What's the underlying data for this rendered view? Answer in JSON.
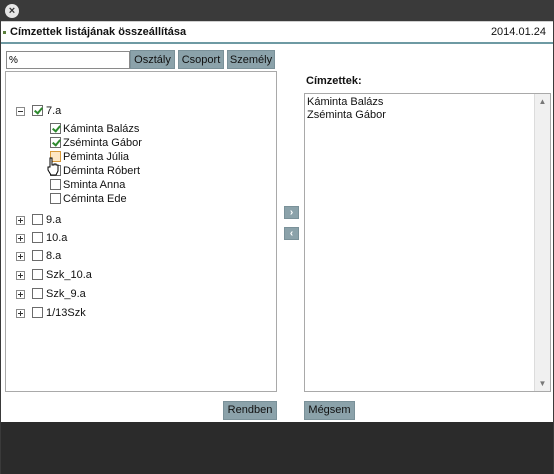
{
  "window": {
    "close_icon": "×"
  },
  "header": {
    "title": "Címzettek listájának összeállítása",
    "date": "2014.01.24"
  },
  "filter": {
    "search_value": "%",
    "buttons": {
      "osztaly": "Osztály",
      "csoport": "Csoport",
      "szemely": "Személy"
    }
  },
  "tree": {
    "groups": [
      {
        "label": "7.a",
        "expanded": true,
        "checked": true,
        "children": [
          {
            "label": "Káminta Balázs",
            "checked": true
          },
          {
            "label": "Zséminta Gábor",
            "checked": true
          },
          {
            "label": "Péminta Júlia",
            "checked": false,
            "hover": true
          },
          {
            "label": "Déminta Róbert",
            "checked": false
          },
          {
            "label": "Sminta Anna",
            "checked": false
          },
          {
            "label": "Céminta Ede",
            "checked": false
          }
        ]
      },
      {
        "label": "9.a",
        "expanded": false,
        "checked": false
      },
      {
        "label": "10.a",
        "expanded": false,
        "checked": false
      },
      {
        "label": "8.a",
        "expanded": false,
        "checked": false
      },
      {
        "label": "Szk_10.a",
        "expanded": false,
        "checked": false
      },
      {
        "label": "Szk_9.a",
        "expanded": false,
        "checked": false
      },
      {
        "label": "1/13Szk",
        "expanded": false,
        "checked": false
      }
    ]
  },
  "transfer": {
    "add_icon": "›",
    "remove_icon": "‹"
  },
  "recipients": {
    "label": "Címzettek:",
    "items": [
      "Káminta Balázs",
      "Zséminta Gábor"
    ],
    "scroll_up_icon": "▲",
    "scroll_down_icon": "▼"
  },
  "actions": {
    "ok": "Rendben",
    "cancel": "Mégsem"
  },
  "colors": {
    "button_bg": "#8ba2aa",
    "title_underline": "#6e9aa3",
    "check_green": "#2d8a2d",
    "window_bg": "#3a3a3a"
  }
}
